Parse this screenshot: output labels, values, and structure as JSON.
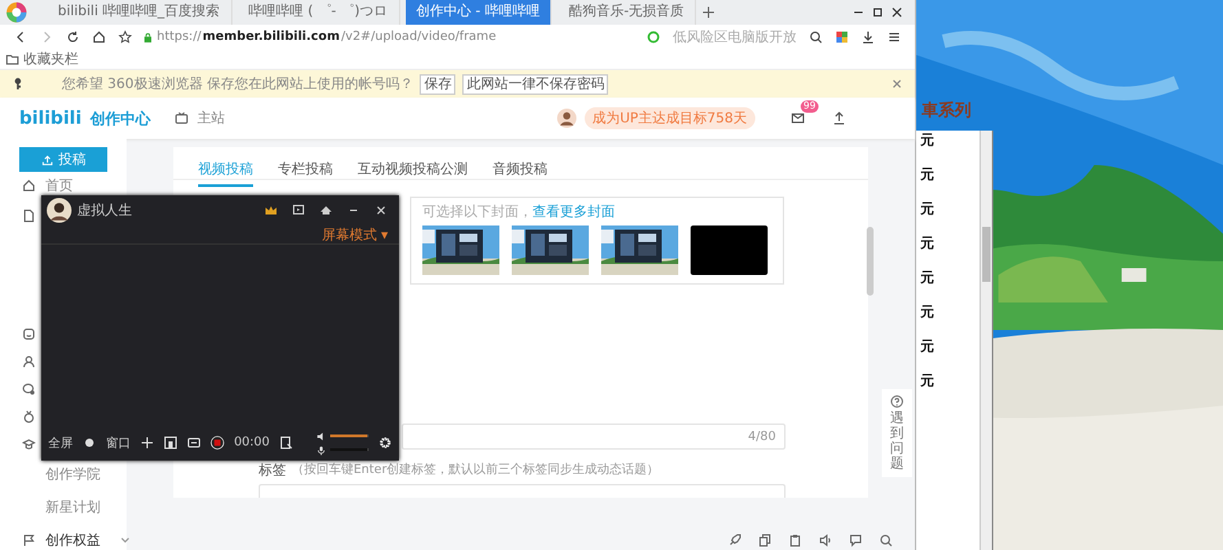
{
  "browser": {
    "tabs": [
      {
        "title": "bilibili 哔哩哔哩_百度搜索",
        "selected": false
      },
      {
        "title": "哔哩哔哩 ( ゜- ゜)つロ",
        "selected": false
      },
      {
        "title": "创作中心 - 哔哩哔哩",
        "selected": true
      },
      {
        "title": "酷狗音乐-无损音质",
        "selected": false
      }
    ],
    "url_scheme": "https://",
    "url_host": "member.bilibili.com",
    "url_path": "/v2#/upload/video/frame",
    "address_hint": "低风险区电脑版开放",
    "bookmarks": "收藏夹栏",
    "password_bar": {
      "message": "您希望 360极速浏览器 保存您在此网站上使用的帐号吗？",
      "buttons": [
        "保存",
        "此网站一律不保存密码"
      ]
    }
  },
  "header": {
    "logo": "bilibili",
    "title": "创作中心",
    "main_site": "主站",
    "promo": "成为UP主达成目标758天",
    "badge": "99"
  },
  "sidebar": {
    "upload": "投稿",
    "items": [
      {
        "label": "首页",
        "kind": "home"
      },
      {
        "label": "创作学院",
        "kind": "text"
      },
      {
        "label": "新星计划",
        "kind": "text"
      },
      {
        "label": "创作权益",
        "kind": "flag"
      }
    ]
  },
  "content": {
    "tabs": [
      {
        "label": "视频投稿",
        "selected": true
      },
      {
        "label": "专栏投稿",
        "selected": false
      },
      {
        "label": "互动视频投稿公测",
        "selected": false
      },
      {
        "label": "音频投稿",
        "selected": false
      }
    ],
    "cover_hint": "可选择以下封面，",
    "cover_link": "查看更多封面",
    "covers": [
      {
        "kind": "picture"
      },
      {
        "kind": "picture"
      },
      {
        "kind": "picture"
      },
      {
        "kind": "blank"
      }
    ],
    "title_counter": "4/80",
    "tag_label": "标签",
    "tag_hint": "（按回车键Enter创建标签，默认以前三个标签同步生成动态话题）",
    "help": "遇到问题"
  },
  "recorder": {
    "user": "虚拟人生",
    "mode": "屏幕模式 ▾",
    "fullscreen": "全屏",
    "window": "窗口",
    "time": "00:00",
    "sliders": [
      {
        "kind": "speaker",
        "level": 0.95,
        "muted": false
      },
      {
        "kind": "mic",
        "level": 0.95,
        "muted": true
      }
    ]
  },
  "desktop": {
    "window_title": "車系列",
    "list": [
      "元",
      "元",
      "元",
      "元",
      "元",
      "元",
      "元",
      "元"
    ]
  }
}
